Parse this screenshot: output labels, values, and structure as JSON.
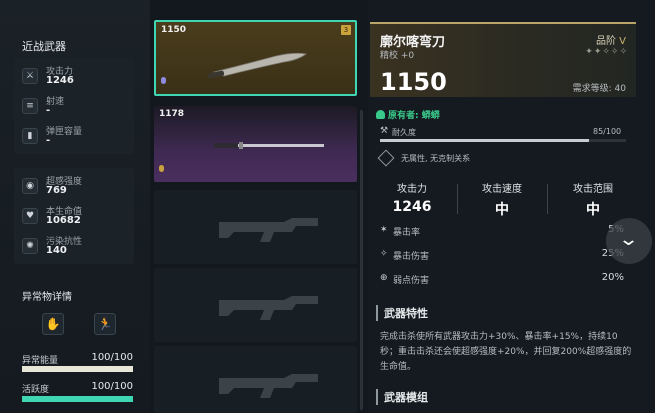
{
  "left": {
    "section_title": "近战武器",
    "stats_group1": [
      {
        "icon": "attack-icon",
        "label": "攻击力",
        "value": "1246"
      },
      {
        "icon": "fire-rate-icon",
        "label": "射速",
        "value": "-"
      },
      {
        "icon": "magazine-icon",
        "label": "弹匣容量",
        "value": "-"
      }
    ],
    "stats_group2": [
      {
        "icon": "transcendence-icon",
        "label": "超感强度",
        "value": "769"
      },
      {
        "icon": "heart-icon",
        "label": "本生命值",
        "value": "10682"
      },
      {
        "icon": "pollution-icon",
        "label": "污染抗性",
        "value": "140"
      }
    ],
    "anomaly_title": "异常物详情",
    "anomaly_energy_label": "异常能量",
    "anomaly_energy_value": "100/100",
    "anomaly_energy_level": 1.0,
    "activity_label": "活跃度",
    "activity_value": "100/100",
    "activity_level": 1.0
  },
  "cards": [
    {
      "number": "1150",
      "badge": "3",
      "selected": true
    },
    {
      "number": "1178",
      "badge": "",
      "selected": false
    },
    {
      "number": "",
      "badge": "",
      "selected": false
    },
    {
      "number": "",
      "badge": "",
      "selected": false
    },
    {
      "number": "",
      "badge": "",
      "selected": false
    }
  ],
  "detail": {
    "name": "廓尔喀弯刀",
    "refine": "精校 +0",
    "grade_label": "品阶",
    "grade_value": "V",
    "stars": "✦✦✧✧✧",
    "power": "1150",
    "required_level": "需求等级: 40",
    "owner": "原有者: 蟒蟒",
    "durability_label": "耐久度",
    "durability_value": "85/100",
    "durability_level": 0.85,
    "element_text": "无属性, 无克制关系",
    "stats": [
      {
        "label": "攻击力",
        "value": "1246"
      },
      {
        "label": "攻击速度",
        "value": "中"
      },
      {
        "label": "攻击范围",
        "value": "中"
      }
    ],
    "sub_stats": [
      {
        "label": "暴击率",
        "value": "5%"
      },
      {
        "label": "暴击伤害",
        "value": "25%"
      },
      {
        "label": "弱点伤害",
        "value": "20%"
      }
    ],
    "trait_title": "武器特性",
    "trait_text": "完成击杀使所有武器攻击力+30%、暴击率+15%，持续10秒；重击击杀还会使超感强度+20%，并回复200%超感强度的生命值。",
    "module_title": "武器模组"
  },
  "colors": {
    "accent_teal": "#3fd6b4",
    "selected_gold": "#5a4a1f",
    "purple_card": "#3f2a52",
    "owner_green": "#39c98a"
  }
}
